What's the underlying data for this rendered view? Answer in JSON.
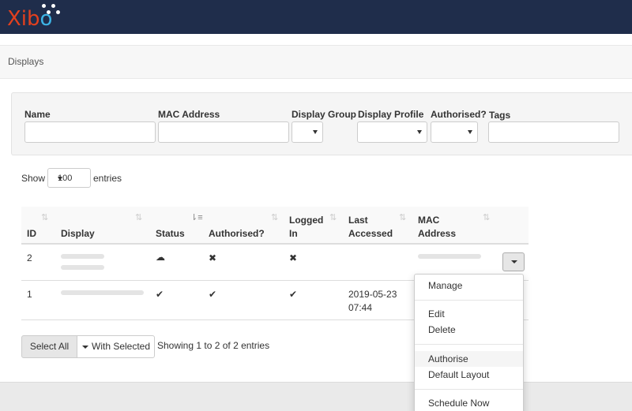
{
  "app": {
    "logo_text_part1": "Xib",
    "logo_text_part2": "o"
  },
  "breadcrumb": {
    "title": "Displays"
  },
  "filters": {
    "name_label": "Name",
    "mac_label": "MAC Address",
    "display_group_label": "Display Group",
    "display_profile_label": "Display Profile",
    "authorised_label": "Authorised?",
    "tags_label": "Tags"
  },
  "length": {
    "show": "Show",
    "value": "100",
    "entries": "entries"
  },
  "table": {
    "headers": {
      "id": "ID",
      "display": "Display",
      "status": "Status",
      "authorised": "Authorised?",
      "logged_in_1": "Logged",
      "logged_in_2": "In",
      "last_accessed_1": "Last",
      "last_accessed_2": "Accessed",
      "mac_1": "MAC",
      "mac_2": "Address"
    },
    "rows": [
      {
        "id": "2",
        "status_icon": "cloud-download-icon",
        "status": "☁",
        "authorised": "✖",
        "logged_in": "✖",
        "last_accessed_1": "",
        "last_accessed_2": ""
      },
      {
        "id": "1",
        "status_icon": "check-icon",
        "status": "✔",
        "authorised": "✔",
        "logged_in": "✔",
        "last_accessed_1": "2019-05-23",
        "last_accessed_2": "07:44"
      }
    ]
  },
  "row_menu": {
    "items": [
      "Manage",
      "Edit",
      "Delete",
      "Authorise",
      "Default Layout",
      "Schedule Now"
    ]
  },
  "bulk": {
    "select_all": "Select All",
    "with_selected": "With Selected"
  },
  "info": "Showing 1 to 2 of 2 entries",
  "colors": {
    "topbar": "#1f2d4b",
    "logo_red": "#e2401e",
    "logo_blue": "#3db5e6"
  }
}
